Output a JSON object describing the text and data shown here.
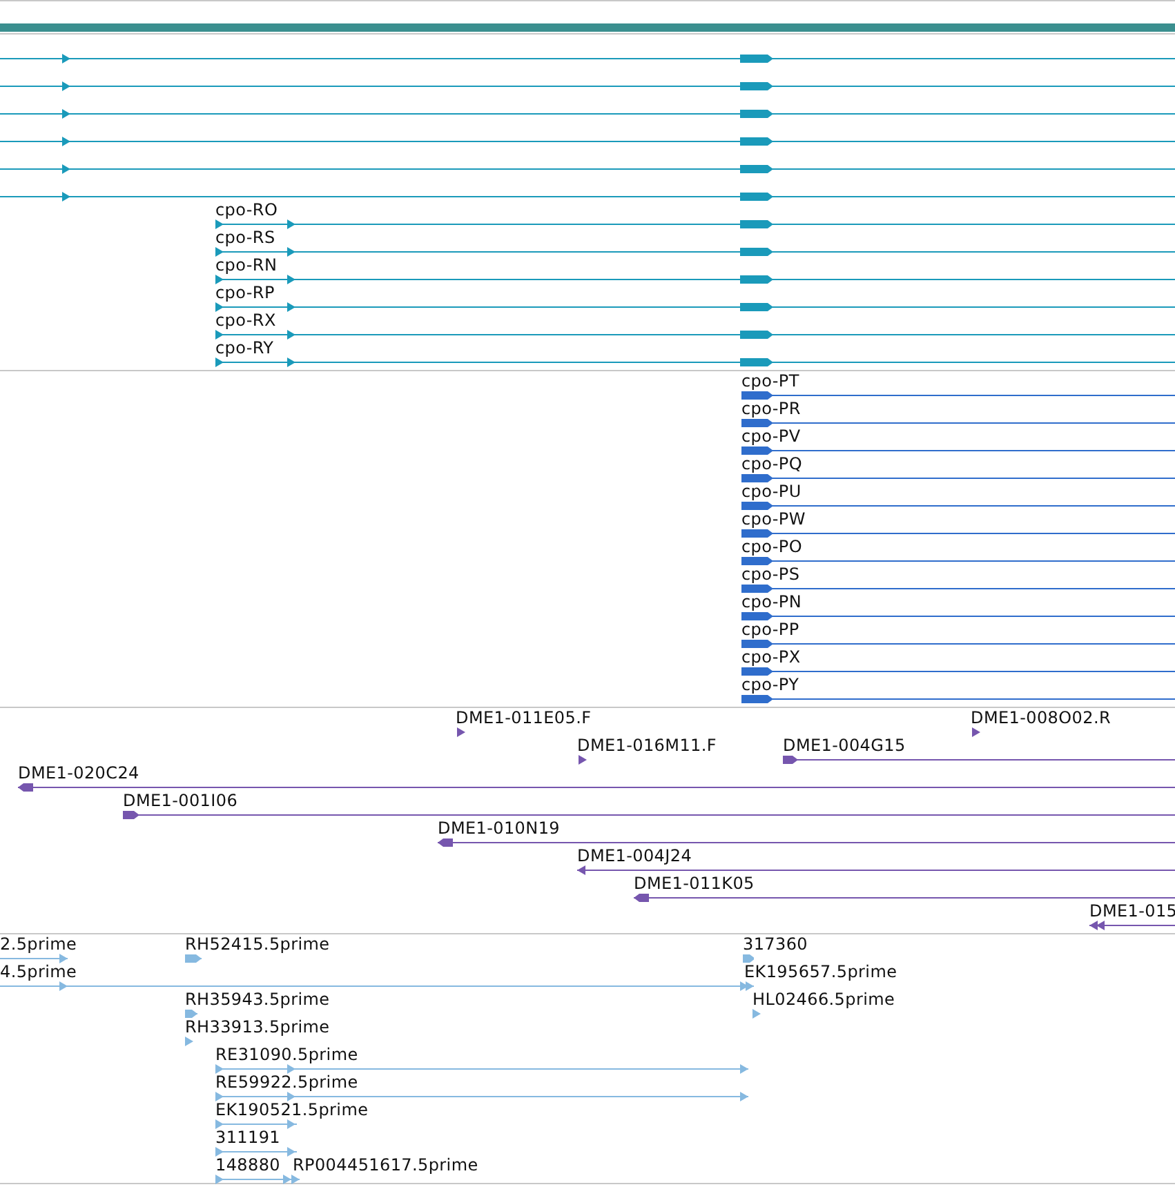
{
  "header": {
    "color": "#3b8f8f"
  },
  "tracks": [
    {
      "color": "#1a9aba",
      "rows": [
        {
          "features": [
            {
              "forward": true
            }
          ]
        },
        {
          "features": [
            {
              "forward": true
            }
          ]
        },
        {
          "features": [
            {
              "forward": true
            }
          ]
        },
        {
          "features": [
            {
              "forward": true
            }
          ]
        },
        {
          "features": [
            {
              "forward": true
            }
          ]
        },
        {
          "features": [
            {
              "forward": true
            }
          ]
        },
        {
          "features": [
            {
              "label": "cpo-RO",
              "forward": true
            }
          ]
        },
        {
          "features": [
            {
              "label": "cpo-RS",
              "forward": true
            }
          ]
        },
        {
          "features": [
            {
              "label": "cpo-RN",
              "forward": true
            }
          ]
        },
        {
          "features": [
            {
              "label": "cpo-RP",
              "forward": true
            }
          ]
        },
        {
          "features": [
            {
              "label": "cpo-RX",
              "forward": true
            }
          ]
        },
        {
          "features": [
            {
              "label": "cpo-RY",
              "forward": true
            }
          ]
        }
      ]
    },
    {
      "color": "#2f6dcc",
      "rows": [
        {
          "features": [
            {
              "label": "cpo-PT",
              "forward": true
            }
          ]
        },
        {
          "features": [
            {
              "label": "cpo-PR",
              "forward": true
            }
          ]
        },
        {
          "features": [
            {
              "label": "cpo-PV",
              "forward": true
            }
          ]
        },
        {
          "features": [
            {
              "label": "cpo-PQ",
              "forward": true
            }
          ]
        },
        {
          "features": [
            {
              "label": "cpo-PU",
              "forward": true
            }
          ]
        },
        {
          "features": [
            {
              "label": "cpo-PW",
              "forward": true
            }
          ]
        },
        {
          "features": [
            {
              "label": "cpo-PO",
              "forward": true
            }
          ]
        },
        {
          "features": [
            {
              "label": "cpo-PS",
              "forward": true
            }
          ]
        },
        {
          "features": [
            {
              "label": "cpo-PN",
              "forward": true
            }
          ]
        },
        {
          "features": [
            {
              "label": "cpo-PP",
              "forward": true
            }
          ]
        },
        {
          "features": [
            {
              "label": "cpo-PX",
              "forward": true
            }
          ]
        },
        {
          "features": [
            {
              "label": "cpo-PY",
              "forward": true
            }
          ]
        }
      ]
    },
    {
      "color": "#7656ae",
      "rows": [
        {
          "features": [
            {
              "label": "DME1-011E05.F",
              "forward": true
            },
            {
              "label": "DME1-008O02.R",
              "forward": true
            }
          ]
        },
        {
          "features": [
            {
              "label": "DME1-016M11.F",
              "forward": true
            },
            {
              "label": "DME1-004G15",
              "forward": true
            }
          ]
        },
        {
          "features": [
            {
              "label": "DME1-020C24",
              "forward": false
            }
          ]
        },
        {
          "features": [
            {
              "label": "DME1-001I06",
              "forward": true
            }
          ]
        },
        {
          "features": [
            {
              "label": "DME1-010N19",
              "forward": false
            }
          ]
        },
        {
          "features": [
            {
              "label": "DME1-004J24",
              "forward": false
            }
          ]
        },
        {
          "features": [
            {
              "label": "DME1-011K05",
              "forward": false
            }
          ]
        },
        {
          "features": [
            {
              "label": "DME1-015",
              "forward": false
            }
          ]
        }
      ]
    },
    {
      "color": "#86b9e0",
      "rows": [
        {
          "features": [
            {
              "label": "2.5prime",
              "forward": true
            },
            {
              "label": "RH52415.5prime",
              "forward": true
            },
            {
              "label": "317360",
              "forward": true
            }
          ]
        },
        {
          "features": [
            {
              "label": "4.5prime",
              "forward": true
            },
            {
              "label": "EK195657.5prime",
              "forward": true
            }
          ]
        },
        {
          "features": [
            {
              "label": "RH35943.5prime",
              "forward": true
            },
            {
              "label": "HL02466.5prime",
              "forward": true
            }
          ]
        },
        {
          "features": [
            {
              "label": "RH33913.5prime",
              "forward": true
            }
          ]
        },
        {
          "features": [
            {
              "label": "RE31090.5prime",
              "forward": true
            }
          ]
        },
        {
          "features": [
            {
              "label": "RE59922.5prime",
              "forward": true
            }
          ]
        },
        {
          "features": [
            {
              "label": "EK190521.5prime",
              "forward": true
            }
          ]
        },
        {
          "features": [
            {
              "label": "311191",
              "forward": true
            }
          ]
        },
        {
          "features": [
            {
              "label": "148880",
              "forward": true
            },
            {
              "label": "RP004451617.5prime"
            }
          ]
        }
      ]
    }
  ]
}
